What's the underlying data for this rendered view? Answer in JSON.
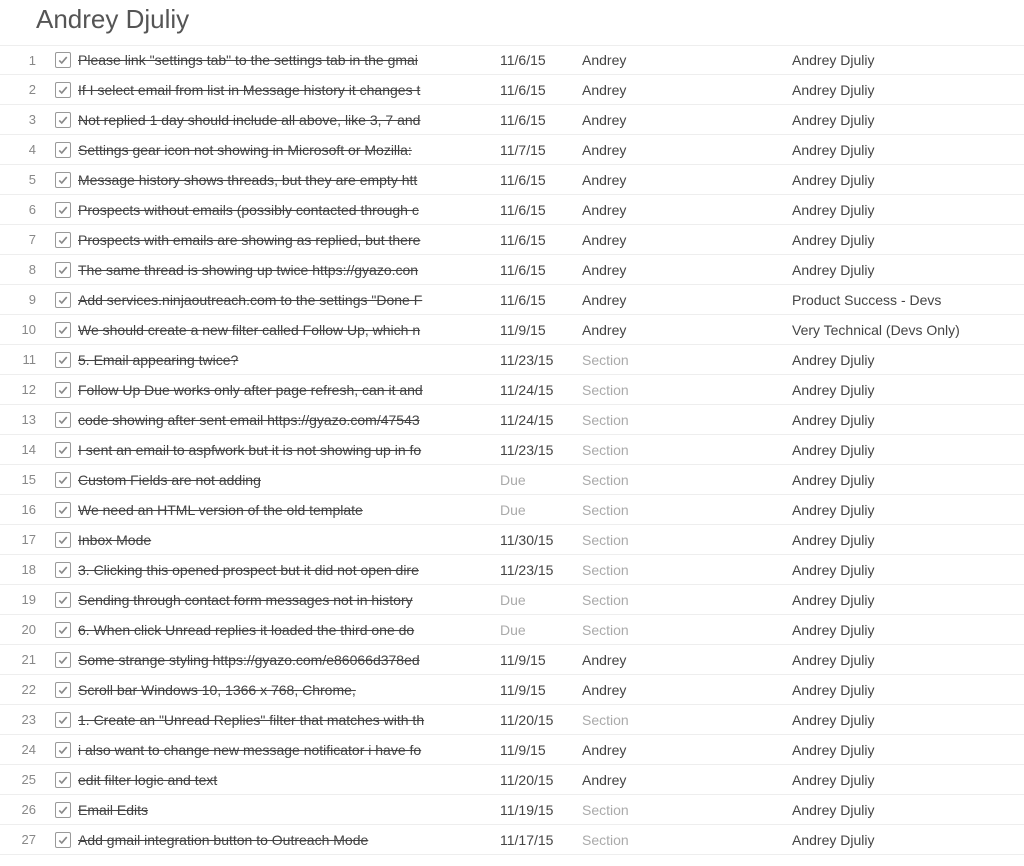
{
  "title": "Andrey Djuliy",
  "rows": [
    {
      "num": "1",
      "checked": true,
      "strike": true,
      "task": "Please link \"settings tab\" to the settings tab in the gmai",
      "date": "11/6/15",
      "date_muted": false,
      "owner": "Andrey",
      "owner_muted": false,
      "assignee": "Andrey Djuliy"
    },
    {
      "num": "2",
      "checked": true,
      "strike": true,
      "task": "If I select email from list in Message history it changes t",
      "date": "11/6/15",
      "date_muted": false,
      "owner": "Andrey",
      "owner_muted": false,
      "assignee": "Andrey Djuliy"
    },
    {
      "num": "3",
      "checked": true,
      "strike": true,
      "task": "Not replied 1 day should include all above, like 3, 7 and",
      "date": "11/6/15",
      "date_muted": false,
      "owner": "Andrey",
      "owner_muted": false,
      "assignee": "Andrey Djuliy"
    },
    {
      "num": "4",
      "checked": true,
      "strike": true,
      "task": "Settings gear icon not showing in Microsoft or Mozilla:",
      "date": "11/7/15",
      "date_muted": false,
      "owner": "Andrey",
      "owner_muted": false,
      "assignee": "Andrey Djuliy"
    },
    {
      "num": "5",
      "checked": true,
      "strike": true,
      "task": "Message history shows threads, but they are empty htt",
      "date": "11/6/15",
      "date_muted": false,
      "owner": "Andrey",
      "owner_muted": false,
      "assignee": "Andrey Djuliy"
    },
    {
      "num": "6",
      "checked": true,
      "strike": true,
      "task": "Prospects without emails (possibly contacted through c",
      "date": "11/6/15",
      "date_muted": false,
      "owner": "Andrey",
      "owner_muted": false,
      "assignee": "Andrey Djuliy"
    },
    {
      "num": "7",
      "checked": true,
      "strike": true,
      "task": "Prospects with emails are showing as replied, but there",
      "date": "11/6/15",
      "date_muted": false,
      "owner": "Andrey",
      "owner_muted": false,
      "assignee": "Andrey Djuliy"
    },
    {
      "num": "8",
      "checked": true,
      "strike": true,
      "task": "The same thread is showing up twice https://gyazo.con",
      "date": "11/6/15",
      "date_muted": false,
      "owner": "Andrey",
      "owner_muted": false,
      "assignee": "Andrey Djuliy"
    },
    {
      "num": "9",
      "checked": true,
      "strike": true,
      "task": "Add services.ninjaoutreach.com to the settings \"Done F",
      "date": "11/6/15",
      "date_muted": false,
      "owner": "Andrey",
      "owner_muted": false,
      "assignee": "Product Success - Devs"
    },
    {
      "num": "10",
      "checked": true,
      "strike": true,
      "task": "We should create a new filter called Follow Up, which n",
      "date": "11/9/15",
      "date_muted": false,
      "owner": "Andrey",
      "owner_muted": false,
      "assignee": "Very Technical (Devs Only)"
    },
    {
      "num": "11",
      "checked": true,
      "strike": true,
      "task": "5. Email appearing twice?",
      "date": "11/23/15",
      "date_muted": false,
      "owner": "Section",
      "owner_muted": true,
      "assignee": "Andrey Djuliy"
    },
    {
      "num": "12",
      "checked": true,
      "strike": true,
      "task": "Follow Up Due works only after page refresh, can it and",
      "date": "11/24/15",
      "date_muted": false,
      "owner": "Section",
      "owner_muted": true,
      "assignee": "Andrey Djuliy"
    },
    {
      "num": "13",
      "checked": true,
      "strike": true,
      "task": "code showing after sent email https://gyazo.com/47543",
      "date": "11/24/15",
      "date_muted": false,
      "owner": "Section",
      "owner_muted": true,
      "assignee": "Andrey Djuliy"
    },
    {
      "num": "14",
      "checked": true,
      "strike": true,
      "task": "I sent an email to aspfwork but it is not showing up in fo",
      "date": "11/23/15",
      "date_muted": false,
      "owner": "Section",
      "owner_muted": true,
      "assignee": "Andrey Djuliy"
    },
    {
      "num": "15",
      "checked": true,
      "strike": true,
      "task": "Custom Fields are not adding",
      "date": "Due",
      "date_muted": true,
      "owner": "Section",
      "owner_muted": true,
      "assignee": "Andrey Djuliy"
    },
    {
      "num": "16",
      "checked": true,
      "strike": true,
      "task": "We need an HTML version of the old template",
      "date": "Due",
      "date_muted": true,
      "owner": "Section",
      "owner_muted": true,
      "assignee": "Andrey Djuliy"
    },
    {
      "num": "17",
      "checked": true,
      "strike": true,
      "task": "Inbox Mode",
      "date": "11/30/15",
      "date_muted": false,
      "owner": "Section",
      "owner_muted": true,
      "assignee": "Andrey Djuliy"
    },
    {
      "num": "18",
      "checked": true,
      "strike": true,
      "task": "3. Clicking this opened prospect but it did not open dire",
      "date": "11/23/15",
      "date_muted": false,
      "owner": "Section",
      "owner_muted": true,
      "assignee": "Andrey Djuliy"
    },
    {
      "num": "19",
      "checked": true,
      "strike": true,
      "task": "Sending through contact form messages not in history",
      "date": "Due",
      "date_muted": true,
      "owner": "Section",
      "owner_muted": true,
      "assignee": "Andrey Djuliy"
    },
    {
      "num": "20",
      "checked": true,
      "strike": true,
      "task": "6. When click Unread replies it loaded the third one do",
      "date": "Due",
      "date_muted": true,
      "owner": "Section",
      "owner_muted": true,
      "assignee": "Andrey Djuliy"
    },
    {
      "num": "21",
      "checked": true,
      "strike": true,
      "task": "Some strange styling https://gyazo.com/e86066d378ed",
      "date": "11/9/15",
      "date_muted": false,
      "owner": "Andrey",
      "owner_muted": false,
      "assignee": "Andrey Djuliy"
    },
    {
      "num": "22",
      "checked": true,
      "strike": true,
      "task": "Scroll bar Windows 10, 1366 x 768, Chrome,",
      "date": "11/9/15",
      "date_muted": false,
      "owner": "Andrey",
      "owner_muted": false,
      "assignee": "Andrey Djuliy"
    },
    {
      "num": "23",
      "checked": true,
      "strike": true,
      "task": "1. Create an \"Unread Replies\" filter that matches with th",
      "date": "11/20/15",
      "date_muted": false,
      "owner": "Section",
      "owner_muted": true,
      "assignee": "Andrey Djuliy"
    },
    {
      "num": "24",
      "checked": true,
      "strike": true,
      "task": "i also want to change new message notificator i have fo",
      "date": "11/9/15",
      "date_muted": false,
      "owner": "Andrey",
      "owner_muted": false,
      "assignee": "Andrey Djuliy"
    },
    {
      "num": "25",
      "checked": true,
      "strike": true,
      "task": "edit filter logic and text",
      "date": "11/20/15",
      "date_muted": false,
      "owner": "Andrey",
      "owner_muted": false,
      "assignee": "Andrey Djuliy"
    },
    {
      "num": "26",
      "checked": true,
      "strike": true,
      "task": "Email Edits",
      "date": "11/19/15",
      "date_muted": false,
      "owner": "Section",
      "owner_muted": true,
      "assignee": "Andrey Djuliy"
    },
    {
      "num": "27",
      "checked": true,
      "strike": true,
      "task": "Add gmail integration button to Outreach Mode",
      "date": "11/17/15",
      "date_muted": false,
      "owner": "Section",
      "owner_muted": true,
      "assignee": "Andrey Djuliy"
    }
  ]
}
